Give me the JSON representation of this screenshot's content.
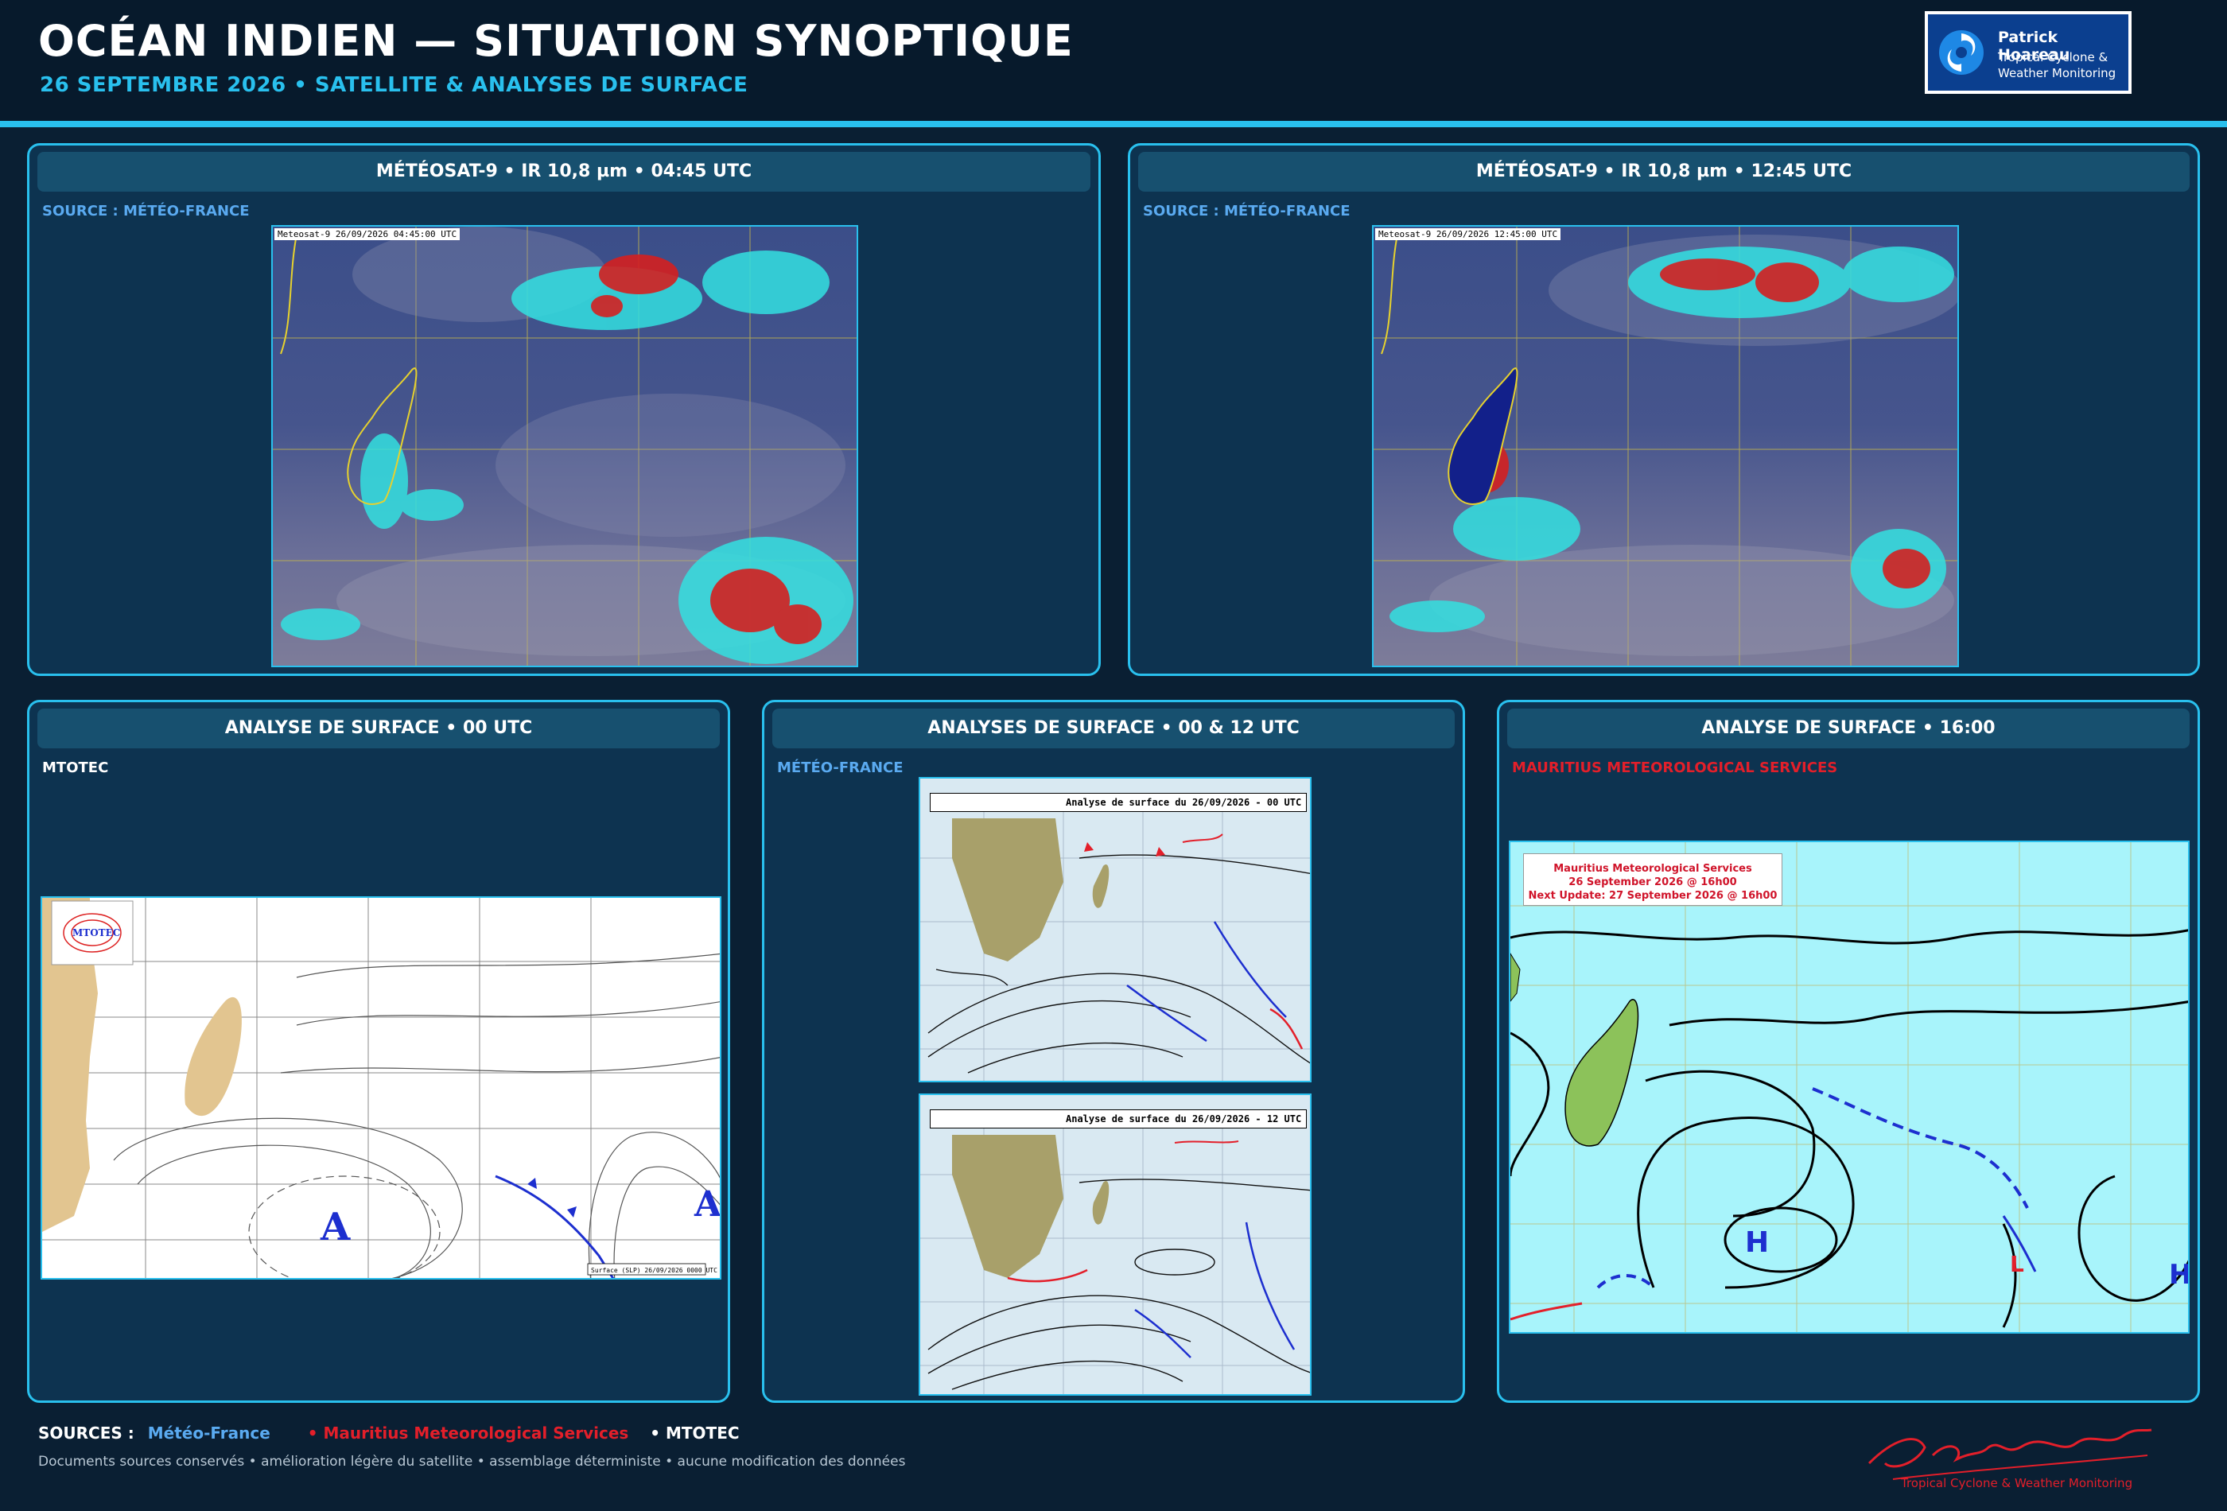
{
  "header": {
    "title": "OCÉAN INDIEN — SITUATION SYNOPTIQUE",
    "subtitle": "26 SEPTEMBRE 2026 • SATELLITE & ANALYSES DE SURFACE"
  },
  "logo": {
    "brand": "Patrick Hoareau",
    "tagline": "Tropical Cyclone & Weather Monitoring"
  },
  "colors": {
    "accent": "#29c0ee",
    "background": "#0a1f33",
    "panel": "#0d3350",
    "mms_red": "#e31f2a",
    "meteo_blue": "#5aaaf0"
  },
  "panels": {
    "sat1": {
      "title": "MÉTÉOSAT-9 • IR 10,8 µm • 04:45 UTC",
      "source": "SOURCE : MÉTÉO-FRANCE",
      "stamp": "Meteosat-9 26/09/2026 04:45:00 UTC"
    },
    "sat2": {
      "title": "MÉTÉOSAT-9 • IR 10,8 µm • 12:45 UTC",
      "source": "SOURCE : MÉTÉO-FRANCE",
      "stamp": "Meteosat-9 26/09/2026 12:45:00 UTC"
    },
    "mtotec": {
      "title": "ANALYSE DE SURFACE • 00 UTC",
      "source": "MTOTEC",
      "logo_text": "MTOTEC",
      "high_label": "A",
      "footer_stamp": "Surface (SLP) 26/09/2026 0000 UTC"
    },
    "meteofrance": {
      "title": "ANALYSES DE SURFACE • 00 & 12 UTC",
      "source": "MÉTÉO-FRANCE",
      "map00_title": "Analyse de surface du 26/09/2026 - 00 UTC",
      "map12_title": "Analyse de surface du 26/09/2026 - 12 UTC"
    },
    "mms": {
      "title": "ANALYSE DE SURFACE • 16:00",
      "source": "MAURITIUS METEOROLOGICAL SERVICES",
      "box_line1": "Mauritius Meteorological Services",
      "box_line2": "26 September 2026 @ 16h00",
      "box_line3": "Next Update: 27 September 2026 @ 16h00",
      "high": "H",
      "low": "L"
    }
  },
  "footer": {
    "sources_label": "SOURCES :",
    "source1": "Météo-France",
    "source2": "• Mauritius Meteorological Services",
    "source3": "• MTOTEC",
    "note": "Documents sources conservés • amélioration légère du satellite • assemblage déterministe • aucune modification des données",
    "signature": "Patrick Hoareau",
    "signature_tag": "Tropical Cyclone & Weather Monitoring"
  }
}
